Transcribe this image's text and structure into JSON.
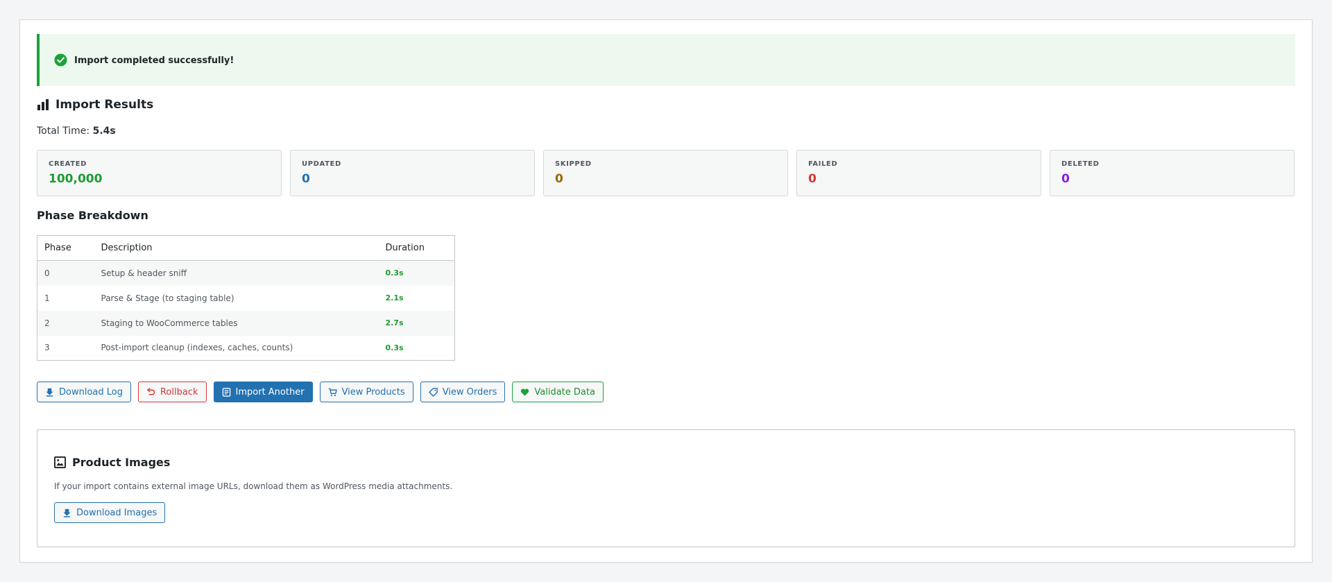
{
  "notice": {
    "message": "Import completed successfully!",
    "icon": "check-circle-icon",
    "color": "#1aa33a"
  },
  "results": {
    "title": "Import Results",
    "icon": "bar-chart-icon",
    "total_time_label": "Total Time:",
    "total_time_value": "5.4s"
  },
  "stats": [
    {
      "label": "CREATED",
      "value": "100,000",
      "color": "#1e9b32"
    },
    {
      "label": "UPDATED",
      "value": "0",
      "color": "#2271b1"
    },
    {
      "label": "SKIPPED",
      "value": "0",
      "color": "#996800"
    },
    {
      "label": "FAILED",
      "value": "0",
      "color": "#d63638"
    },
    {
      "label": "DELETED",
      "value": "0",
      "color": "#8c1adb"
    }
  ],
  "phases": {
    "title": "Phase Breakdown",
    "columns": [
      "Phase",
      "Description",
      "Duration"
    ],
    "rows": [
      {
        "phase": "0",
        "description": "Setup & header sniff",
        "duration": "0.3s"
      },
      {
        "phase": "1",
        "description": "Parse & Stage (to staging table)",
        "duration": "2.1s"
      },
      {
        "phase": "2",
        "description": "Staging to WooCommerce tables",
        "duration": "2.7s"
      },
      {
        "phase": "3",
        "description": "Post-import cleanup (indexes, caches, counts)",
        "duration": "0.3s"
      }
    ]
  },
  "actions": {
    "download_log": "Download Log",
    "rollback": "Rollback",
    "import_another": "Import Another",
    "view_products": "View Products",
    "view_orders": "View Orders",
    "validate_data": "Validate Data"
  },
  "images": {
    "title": "Product Images",
    "icon": "image-icon",
    "description": "If your import contains external image URLs, download them as WordPress media attachments.",
    "button": "Download Images"
  }
}
